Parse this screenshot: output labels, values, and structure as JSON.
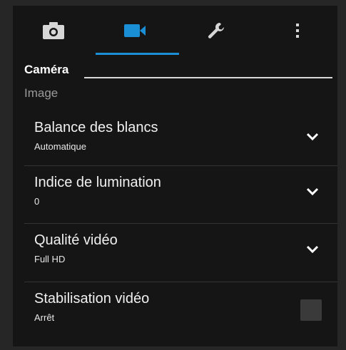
{
  "tabs": [
    {
      "icon": "camera-icon",
      "active": false
    },
    {
      "icon": "video-camera-icon",
      "active": true
    },
    {
      "icon": "wrench-icon",
      "active": false
    },
    {
      "icon": "more-vertical-icon",
      "active": false
    }
  ],
  "section": {
    "title": "Caméra",
    "group": "Image"
  },
  "settings": [
    {
      "title": "Balance des blancs",
      "value": "Automatique",
      "control": "dropdown"
    },
    {
      "title": "Indice de lumination",
      "value": "0",
      "control": "dropdown"
    },
    {
      "title": "Qualité vidéo",
      "value": "Full HD",
      "control": "dropdown"
    },
    {
      "title": "Stabilisation vidéo",
      "value": "Arrêt",
      "control": "checkbox",
      "checked": false
    }
  ],
  "colors": {
    "accent": "#1a8fd6",
    "background": "#151515",
    "text": "#f0f0f0",
    "muted": "#9a9a9a"
  }
}
